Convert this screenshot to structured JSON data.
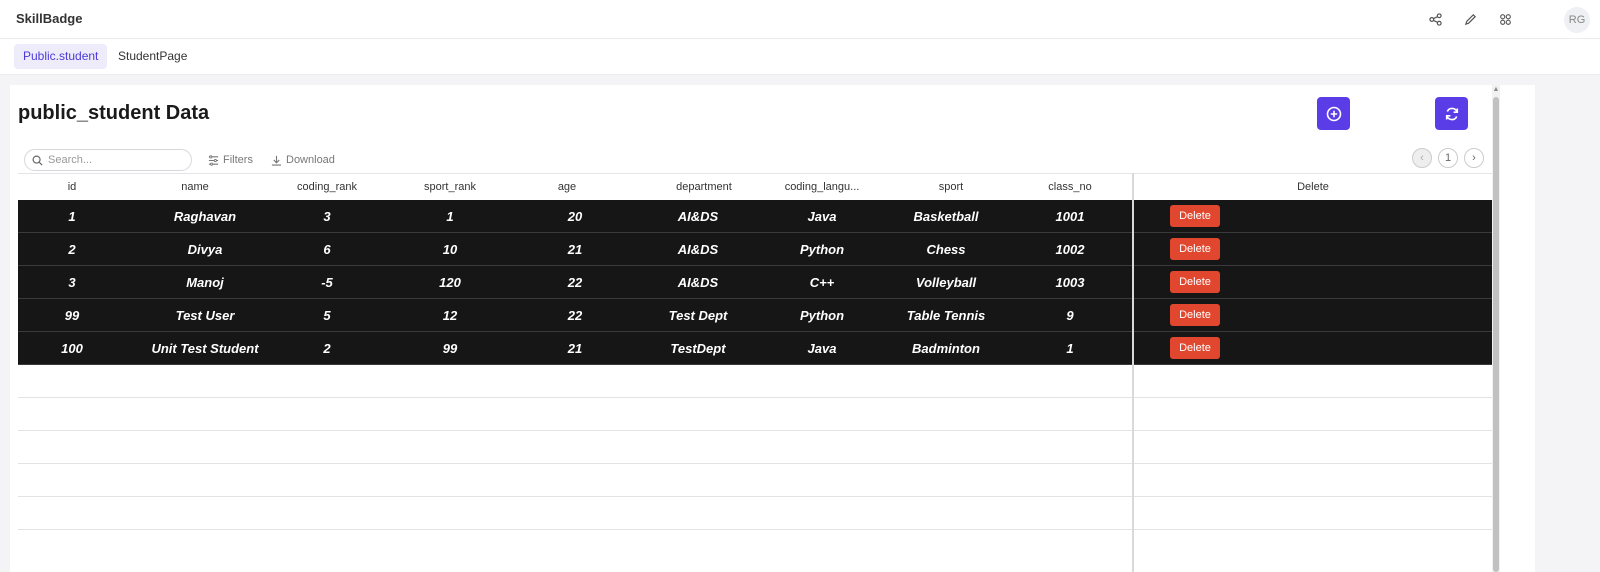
{
  "app": {
    "title": "SkillBadge",
    "avatar_initials": "RG"
  },
  "header_icons": [
    "share-icon",
    "edit-pencil-icon",
    "apps-grid-icon"
  ],
  "tabs": [
    {
      "label": "Public.student",
      "active": true
    },
    {
      "label": "StudentPage",
      "active": false
    }
  ],
  "page": {
    "title": "public_student Data"
  },
  "toolbar": {
    "search_placeholder": "Search...",
    "filters_label": "Filters",
    "download_label": "Download",
    "page_number": "1"
  },
  "table": {
    "columns": [
      "id",
      "name",
      "coding_rank",
      "sport_rank",
      "age",
      "department",
      "coding_langu...",
      "sport",
      "class_no"
    ],
    "action_column": "Delete",
    "delete_label": "Delete",
    "rows": [
      [
        "1",
        "Raghavan",
        "3",
        "1",
        "20",
        "AI&DS",
        "Java",
        "Basketball",
        "1001"
      ],
      [
        "2",
        "Divya",
        "6",
        "10",
        "21",
        "AI&DS",
        "Python",
        "Chess",
        "1002"
      ],
      [
        "3",
        "Manoj",
        "-5",
        "120",
        "22",
        "AI&DS",
        "C++",
        "Volleyball",
        "1003"
      ],
      [
        "99",
        "Test User",
        "5",
        "12",
        "22",
        "Test Dept",
        "Python",
        "Table Tennis",
        "9"
      ],
      [
        "100",
        "Unit Test Student",
        "2",
        "99",
        "21",
        "TestDept",
        "Java",
        "Badminton",
        "1"
      ]
    ]
  },
  "colors": {
    "accent": "#5b3de8",
    "delete": "#e1472f",
    "row_bg": "#161616",
    "active_tab_text": "#4b3bd6"
  }
}
